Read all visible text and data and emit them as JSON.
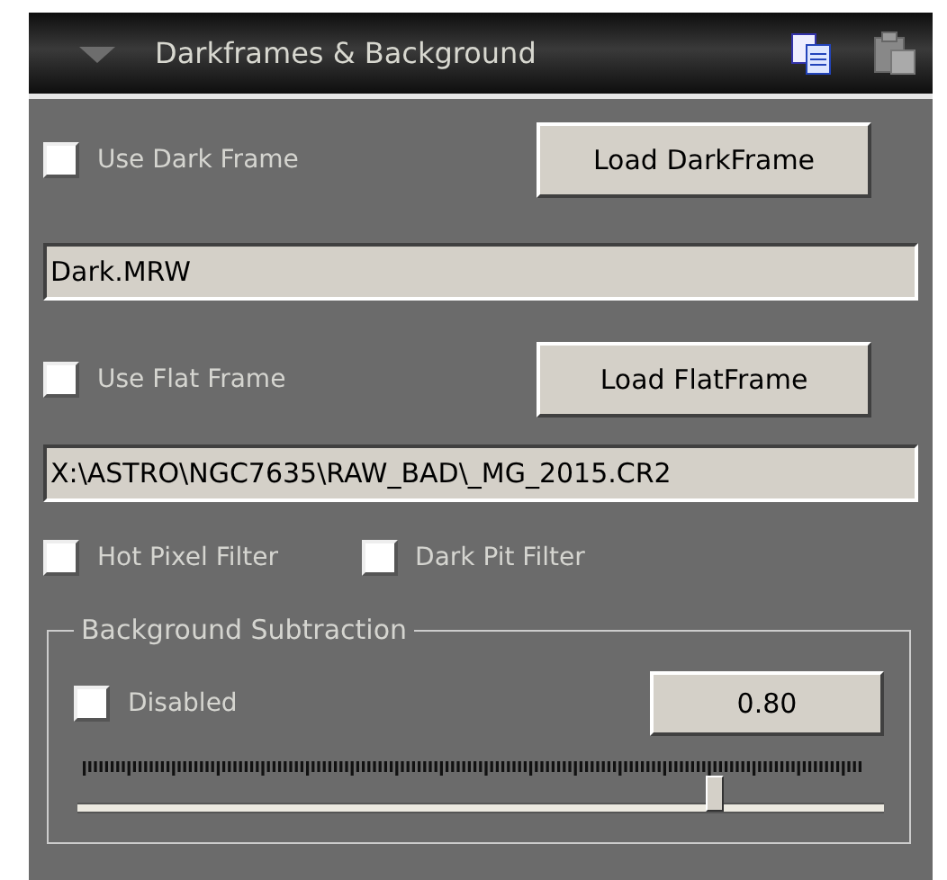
{
  "panel": {
    "title": "Darkframes & Background",
    "expanded": true
  },
  "dark_frame": {
    "checkbox": {
      "label": "Use Dark Frame",
      "checked": false
    },
    "button": "Load DarkFrame",
    "path": "Dark.MRW"
  },
  "flat_frame": {
    "checkbox": {
      "label": "Use Flat Frame",
      "checked": false
    },
    "button": "Load FlatFrame",
    "path": "X:\\ASTRO\\NGC7635\\RAW_BAD\\_MG_2015.CR2"
  },
  "filters": [
    {
      "label": "Hot Pixel Filter",
      "checked": false
    },
    {
      "label": "Dark Pit Filter",
      "checked": false
    }
  ],
  "background_subtraction": {
    "title": "Background Subtraction",
    "checkbox": {
      "label": "Disabled",
      "checked": false
    },
    "value": "0.80",
    "slider": {
      "level": 0.79
    }
  }
}
